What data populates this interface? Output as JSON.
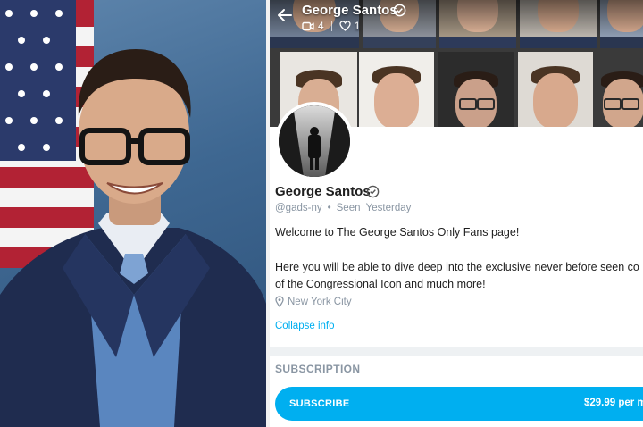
{
  "cover": {
    "name": "George Santos",
    "posts_count": "4",
    "likes_count": "1"
  },
  "profile": {
    "name": "George Santos",
    "handle": "@gads-ny",
    "separator": "•",
    "seen": "Seen  Yesterday",
    "bio_line1": "Welcome to The George Santos Only Fans page!",
    "bio_line2": "Here you will be able to dive deep into the exclusive never before seen co",
    "bio_line3": "of the Congressional Icon and much more!",
    "location": "New York City",
    "collapse_label": "Collapse info"
  },
  "subscription": {
    "heading": "SUBSCRIPTION",
    "button_label": "SUBSCRIBE",
    "price": "$29.99 per m"
  },
  "icons": [
    "back-arrow-icon",
    "verified-icon",
    "video-icon",
    "heart-icon",
    "location-pin-icon"
  ],
  "colors": {
    "accent": "#00aff0",
    "muted": "#8a96a3",
    "text": "#1e1e1e"
  }
}
